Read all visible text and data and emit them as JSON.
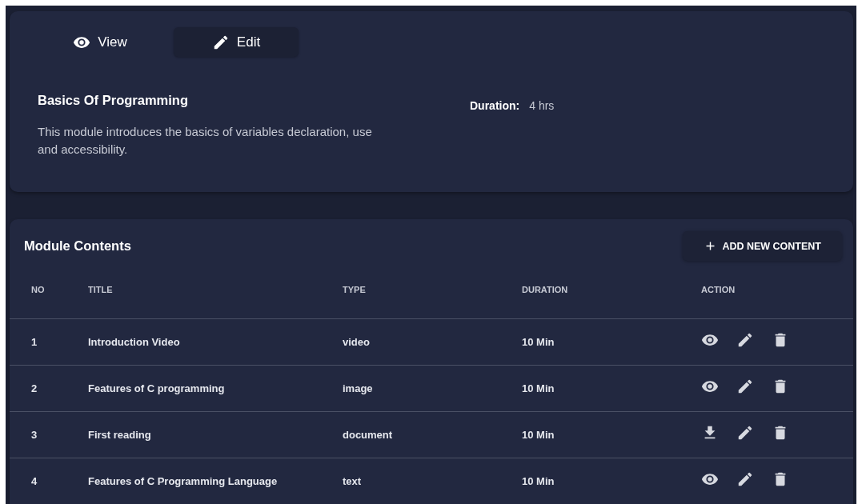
{
  "tabs": [
    {
      "label": "View",
      "kind": "view",
      "selected": false
    },
    {
      "label": "Edit",
      "kind": "edit",
      "selected": true
    }
  ],
  "module": {
    "title": "Basics Of Programming",
    "description": "This module introduces the basics of variables declaration, use and accessibility.",
    "duration_label": "Duration:",
    "duration_value": "4 hrs"
  },
  "contents": {
    "title": "Module Contents",
    "add_button": "ADD NEW CONTENT",
    "columns": [
      "NO",
      "TITLE",
      "TYPE",
      "DURATION",
      "ACTION"
    ],
    "rows": [
      {
        "no": "1",
        "title": "Introduction Video",
        "type": "video",
        "duration": "10 Min",
        "actions": [
          {
            "kind": "view"
          },
          {
            "kind": "edit"
          },
          {
            "kind": "delete"
          }
        ]
      },
      {
        "no": "2",
        "title": "Features of C programming",
        "type": "image",
        "duration": "10 Min",
        "actions": [
          {
            "kind": "view"
          },
          {
            "kind": "edit"
          },
          {
            "kind": "delete"
          }
        ]
      },
      {
        "no": "3",
        "title": "First reading",
        "type": "document",
        "duration": "10 Min",
        "actions": [
          {
            "kind": "download"
          },
          {
            "kind": "edit"
          },
          {
            "kind": "delete"
          }
        ]
      },
      {
        "no": "4",
        "title": "Features of C Programming Language",
        "type": "text",
        "duration": "10 Min",
        "actions": [
          {
            "kind": "view"
          },
          {
            "kind": "edit"
          },
          {
            "kind": "delete"
          }
        ]
      }
    ]
  }
}
